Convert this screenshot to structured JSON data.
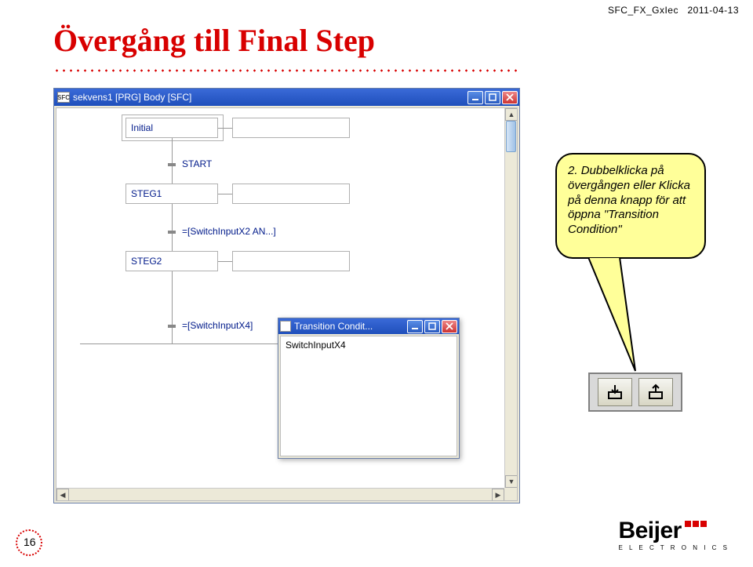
{
  "meta": {
    "doc_id": "SFC_FX_GxIec",
    "date": "2011-04-13"
  },
  "title": "Övergång till Final Step",
  "window": {
    "title": "sekvens1 [PRG] Body [SFC]",
    "app_icon_text": "SFC"
  },
  "sfc": {
    "initial": "Initial",
    "trans1": "START",
    "step1": "STEG1",
    "trans2": "=[SwitchInputX2 AN...]",
    "step2": "STEG2",
    "trans3": "=[SwitchInputX4]"
  },
  "tc_window": {
    "title": "Transition Condit...",
    "content": "SwitchInputX4"
  },
  "callout": {
    "num": "2.",
    "text": "Dubbelklicka på övergången eller Klicka på denna knapp för att öppna \"Transition Condition\""
  },
  "page_number": "16",
  "logo": {
    "name": "Beijer",
    "sub": "E L E C T R O N I C S"
  }
}
